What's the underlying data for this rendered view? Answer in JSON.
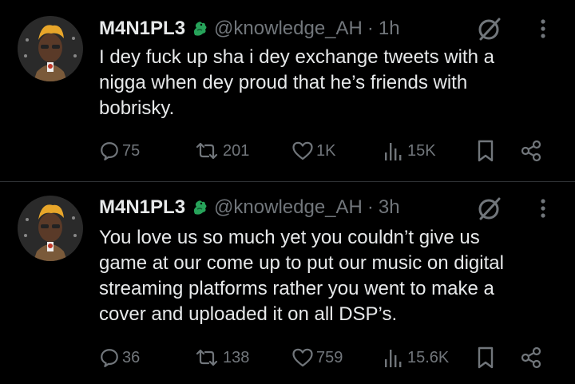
{
  "tweets": [
    {
      "display_name": "M4N1PL3",
      "badge_icon": "dragon-emoji-icon",
      "handle": "@knowledge_AH",
      "separator": "·",
      "time": "1h",
      "text_lines": [
        "I dey fuck up sha i dey exchange tweets with a",
        "nigga when dey proud that he’s friends with",
        "bobrisky."
      ],
      "replies": "75",
      "reposts": "201",
      "likes": "1K",
      "views": "15K"
    },
    {
      "display_name": "M4N1PL3",
      "badge_icon": "dragon-emoji-icon",
      "handle": "@knowledge_AH",
      "separator": "·",
      "time": "3h",
      "text_lines": [
        "You love us so much yet you couldn’t give us",
        "game at our come up to put our music on digital",
        "streaming platforms rather you went to make a",
        "cover and uploaded it on all DSP’s."
      ],
      "replies": "36",
      "reposts": "138",
      "likes": "759",
      "views": "15.6K"
    }
  ],
  "colors": {
    "background": "#000000",
    "text": "#e7e9ea",
    "muted": "#71767b",
    "divider": "#2f3336",
    "dragon": "#27a35a"
  }
}
